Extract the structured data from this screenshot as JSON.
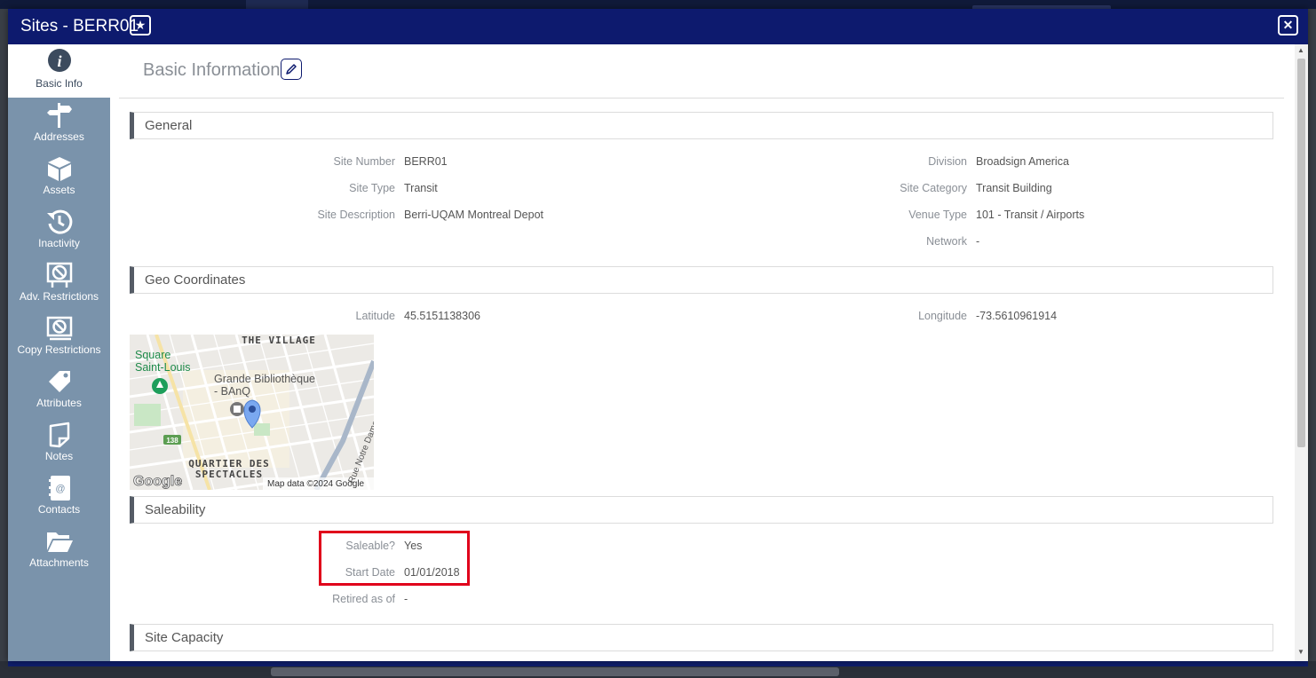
{
  "window": {
    "title": "Sites - BERR01"
  },
  "sidebar": {
    "items": [
      {
        "label": "Basic Info",
        "icon": "info-icon"
      },
      {
        "label": "Addresses",
        "icon": "signpost-icon"
      },
      {
        "label": "Assets",
        "icon": "box-icon"
      },
      {
        "label": "Inactivity",
        "icon": "history-icon"
      },
      {
        "label": "Adv. Restrictions",
        "icon": "prohibited-sign-icon"
      },
      {
        "label": "Copy Restrictions",
        "icon": "prohibited-stack-icon"
      },
      {
        "label": "Attributes",
        "icon": "tags-icon"
      },
      {
        "label": "Notes",
        "icon": "note-icon"
      },
      {
        "label": "Contacts",
        "icon": "address-book-icon"
      },
      {
        "label": "Attachments",
        "icon": "folder-open-icon"
      }
    ]
  },
  "page": {
    "title": "Basic Information"
  },
  "general": {
    "heading": "General",
    "site_number_label": "Site Number",
    "site_number": "BERR01",
    "site_type_label": "Site Type",
    "site_type": "Transit",
    "site_description_label": "Site Description",
    "site_description": "Berri-UQAM Montreal Depot",
    "division_label": "Division",
    "division": "Broadsign America",
    "site_category_label": "Site Category",
    "site_category": "Transit Building",
    "venue_type_label": "Venue Type",
    "venue_type": "101 - Transit / Airports",
    "network_label": "Network",
    "network": "-"
  },
  "geo": {
    "heading": "Geo Coordinates",
    "latitude_label": "Latitude",
    "latitude": "45.5151138306",
    "longitude_label": "Longitude",
    "longitude": "-73.5610961914",
    "map": {
      "labels": {
        "village": "THE VILLAGE",
        "square1": "Square",
        "square2": "Saint-Louis",
        "library1": "Grande Bibliothèque",
        "library2": "- BAnQ",
        "quartier1": "QUARTIER DES",
        "quartier2": "SPECTACLES",
        "street": "Rue Notre Dame",
        "route": "138",
        "logo": "Google",
        "attribution": "Map data ©2024 Google"
      }
    }
  },
  "saleability": {
    "heading": "Saleability",
    "saleable_label": "Saleable?",
    "saleable": "Yes",
    "start_date_label": "Start Date",
    "start_date": "01/01/2018",
    "retired_label": "Retired as of",
    "retired": "-"
  },
  "capacity": {
    "heading": "Site Capacity"
  },
  "colors": {
    "titlebar": "#0d1a6e",
    "sidebar": "#7a93ab",
    "highlight": "#e0001b"
  }
}
